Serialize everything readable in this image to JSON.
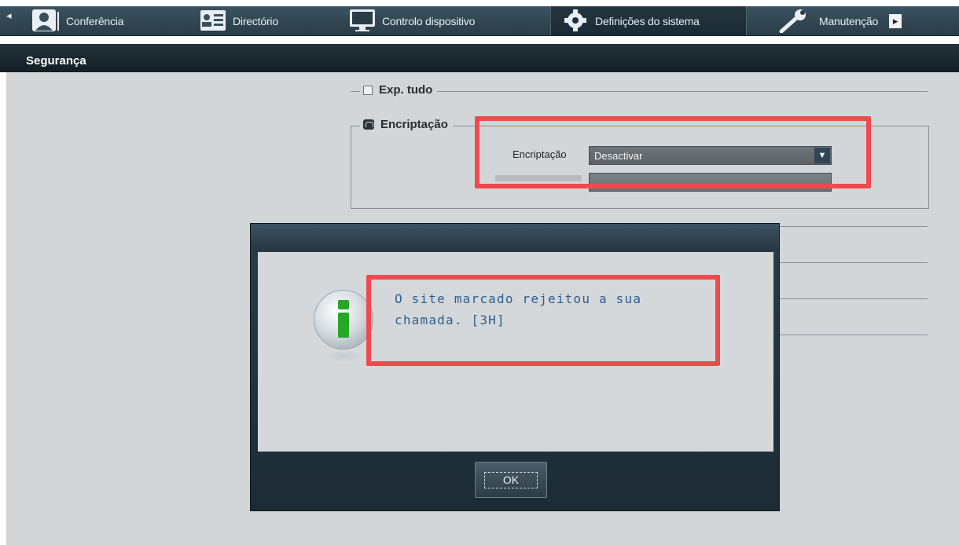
{
  "topnav": {
    "tabs": [
      {
        "label": "Conferência",
        "icon": "person-icon"
      },
      {
        "label": "Directório",
        "icon": "directory-card-icon"
      },
      {
        "label": "Controlo dispositivo",
        "icon": "monitor-icon"
      },
      {
        "label": "Definições do sistema",
        "icon": "gear-icon",
        "active": true
      },
      {
        "label": "Manutenção",
        "icon": "wrench-icon"
      }
    ]
  },
  "section": {
    "title": "Segurança"
  },
  "settings": {
    "export_all_label": "Exp. tudo",
    "encryption_group_label": "Encriptação",
    "encryption_field_label": "Encriptação",
    "encryption_value": "Desactivar"
  },
  "dialog": {
    "message_line1": "O site marcado rejeitou a sua",
    "message_line2": "chamada. [3H]",
    "ok_label": "OK"
  },
  "colors": {
    "highlight": "#ef4a4e",
    "message_text": "#2c5e8f"
  }
}
